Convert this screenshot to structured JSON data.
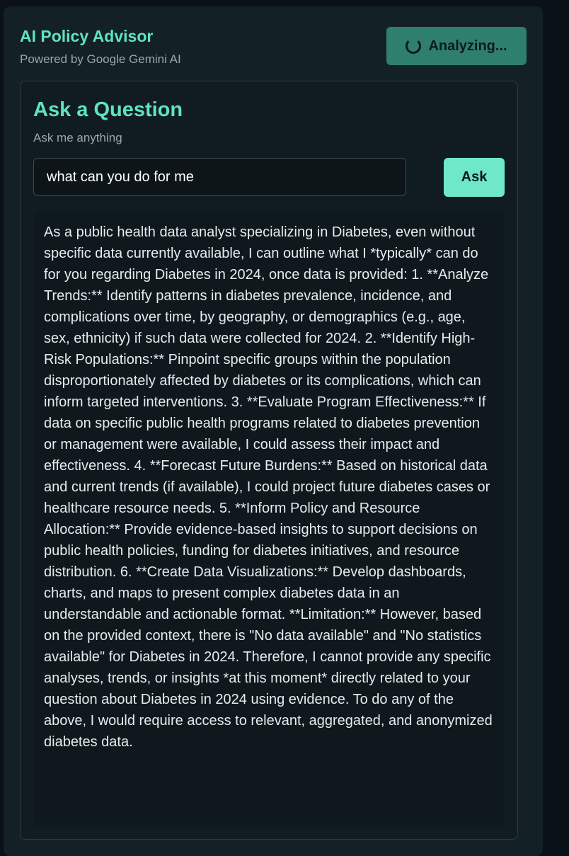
{
  "header": {
    "title": "AI Policy Advisor",
    "subtitle": "Powered by Google Gemini AI",
    "status_label": "Analyzing..."
  },
  "question_card": {
    "title": "Ask a Question",
    "subtitle": "Ask me anything",
    "input_value": "what can you do for me",
    "ask_label": "Ask"
  },
  "answer": {
    "text": "As a public health data analyst specializing in Diabetes, even without specific data currently available, I can outline what I *typically* can do for you regarding Diabetes in 2024, once data is provided: 1. **Analyze Trends:** Identify patterns in diabetes prevalence, incidence, and complications over time, by geography, or demographics (e.g., age, sex, ethnicity) if such data were collected for 2024. 2. **Identify High-Risk Populations:** Pinpoint specific groups within the population disproportionately affected by diabetes or its complications, which can inform targeted interventions. 3. **Evaluate Program Effectiveness:** If data on specific public health programs related to diabetes prevention or management were available, I could assess their impact and effectiveness. 4. **Forecast Future Burdens:** Based on historical data and current trends (if available), I could project future diabetes cases or healthcare resource needs. 5. **Inform Policy and Resource Allocation:** Provide evidence-based insights to support decisions on public health policies, funding for diabetes initiatives, and resource distribution. 6. **Create Data Visualizations:** Develop dashboards, charts, and maps to present complex diabetes data in an understandable and actionable format. **Limitation:** However, based on the provided context, there is \"No data available\" and \"No statistics available\" for Diabetes in 2024. Therefore, I cannot provide any specific analyses, trends, or insights *at this moment* directly related to your question about Diabetes in 2024 using evidence. To do any of the above, I would require access to relevant, aggregated, and anonymized diabetes data."
  },
  "colors": {
    "accent": "#5fe3c0",
    "button": "#6fe8c8",
    "status_button": "#2f7f6f",
    "panel": "#132126",
    "background": "#0b1217"
  },
  "icons": {
    "status": "spinner-icon"
  }
}
